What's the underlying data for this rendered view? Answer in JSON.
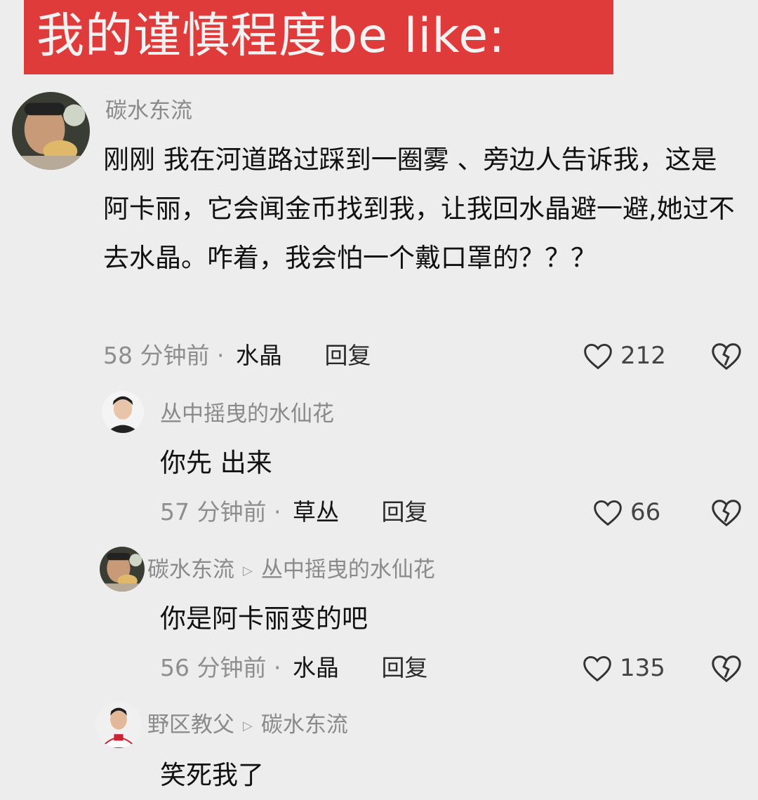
{
  "banner": {
    "title": "我的谨慎程度be like:"
  },
  "comments": [
    {
      "user": "碳水东流",
      "text": "刚刚 我在河道路过踩到一圈雾 、旁边人告诉我，这是阿卡丽，它会闻金币找到我，让我回水晶避一避,她过不去水晶。咋着，我会怕一个戴口罩的？？？",
      "time": "58 分钟前 ·",
      "location": "水晶",
      "reply_label": "回复",
      "likes": "212"
    }
  ],
  "replies": [
    {
      "user": "丛中摇曳的水仙花",
      "text": "你先 出来",
      "time": "57 分钟前 ·",
      "location": "草丛",
      "reply_label": "回复",
      "likes": "66"
    },
    {
      "user": "碳水东流",
      "reply_to": "丛中摇曳的水仙花",
      "text": "你是阿卡丽变的吧",
      "time": "56 分钟前 ·",
      "location": "水晶",
      "reply_label": "回复",
      "likes": "135"
    },
    {
      "user": "野区教父",
      "reply_to": "碳水东流",
      "text": "笑死我了"
    }
  ],
  "icons": {
    "like": "heart-outline-icon",
    "dislike": "broken-heart-icon",
    "reply_to": "triangle-right-icon"
  },
  "colors": {
    "banner": "#df3b3b",
    "background": "#ededed",
    "username": "#8a8a8a"
  }
}
